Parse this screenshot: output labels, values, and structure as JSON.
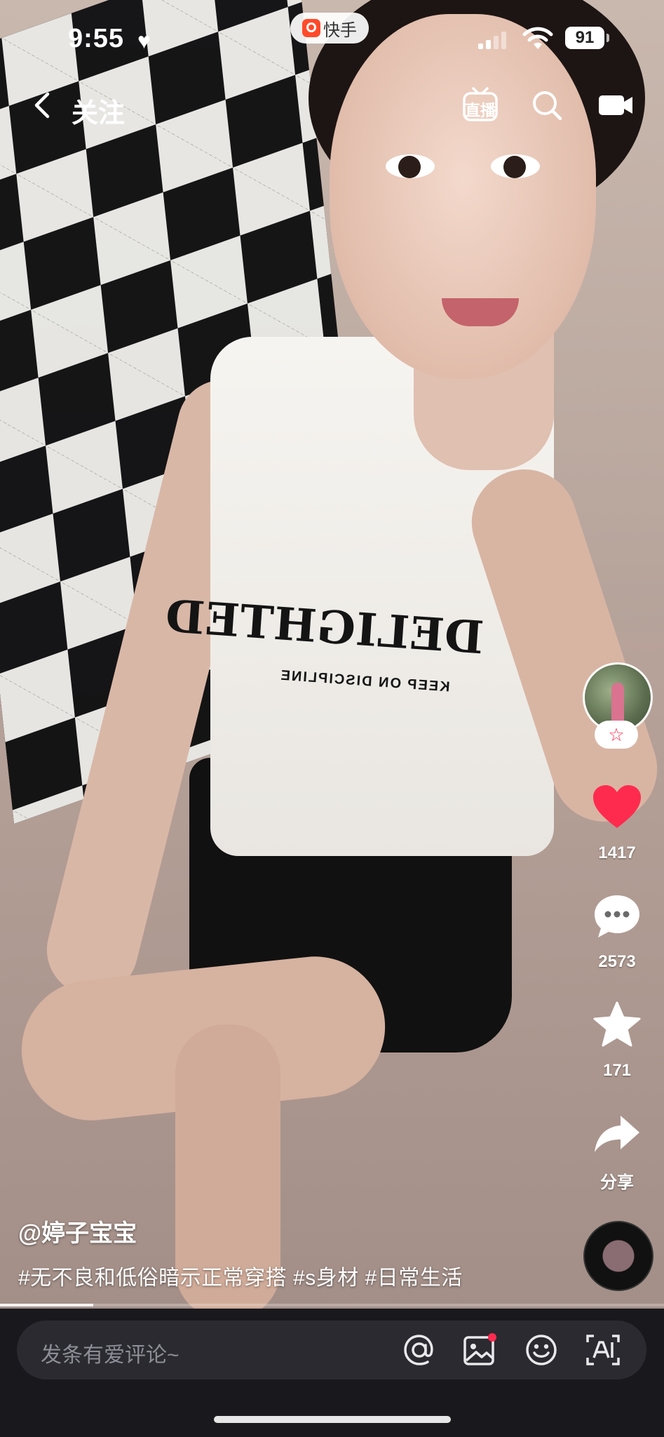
{
  "status_bar": {
    "time": "9:55",
    "app_name": "快手",
    "battery": "91"
  },
  "nav": {
    "title": "关注",
    "live_label": "直播"
  },
  "video": {
    "shirt_text": "DELIGHTED",
    "shirt_subtext": "KEEP ON DISCIPLINE",
    "progress": 0.14
  },
  "actions": {
    "likes": "1417",
    "comments": "2573",
    "favorites": "171",
    "share_label": "分享"
  },
  "caption": {
    "author": "@婷子宝宝",
    "description": "#无不良和低俗暗示正常穿搭 #s身材 #日常生活"
  },
  "comment_bar": {
    "placeholder": "发条有爱评论~"
  },
  "colors": {
    "like": "#ff2b4f",
    "brand": "#ff4a2a",
    "bottom_bg": "#19191d"
  },
  "icons": [
    "heart-icon",
    "back-icon",
    "live-tv-icon",
    "search-icon",
    "camera-icon",
    "star-icon",
    "comment-icon",
    "share-icon",
    "at-icon",
    "image-icon",
    "emoji-icon",
    "ai-icon"
  ]
}
